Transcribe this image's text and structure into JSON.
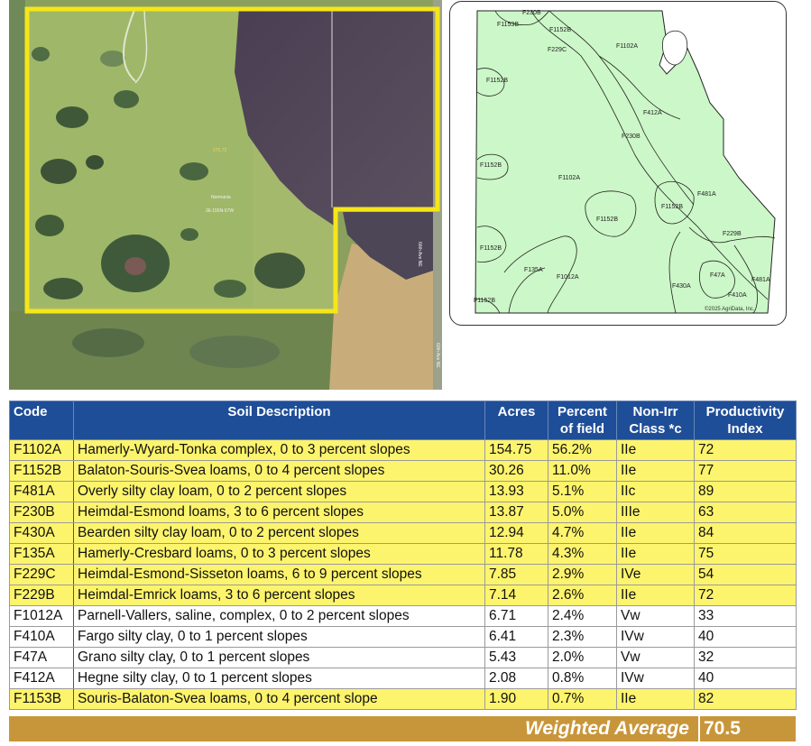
{
  "aerial": {
    "parcel_label": "Normania",
    "parcel_sublabel": "36-155N-57W",
    "acreage_label": "275.72",
    "road_label_1": "66th Ave NE",
    "road_label_2": "60th Ave NE"
  },
  "soil_map": {
    "labels": [
      "F230B",
      "F1153B",
      "F1152B",
      "F229C",
      "F1102A",
      "F1152B",
      "F412A",
      "F230B",
      "F1152B",
      "F1102A",
      "F481A",
      "F1152B",
      "F1152B",
      "F229B",
      "F1152B",
      "F135A",
      "F1012A",
      "F47A",
      "F481A",
      "F430A",
      "F410A",
      "F1152B"
    ],
    "copyright": "©2025 AgriData, Inc."
  },
  "table": {
    "headers": {
      "code": "Code",
      "description": "Soil Description",
      "acres": "Acres",
      "percent_1": "Percent",
      "percent_2": "of field",
      "class_1": "Non-Irr",
      "class_2": "Class *c",
      "pi_1": "Productivity",
      "pi_2": "Index"
    },
    "rows": [
      {
        "code": "F1102A",
        "description": "Hamerly-Wyard-Tonka complex, 0 to 3 percent slopes",
        "acres": "154.75",
        "percent": "56.2%",
        "class": "IIe",
        "pi": "72"
      },
      {
        "code": "F1152B",
        "description": "Balaton-Souris-Svea loams, 0 to 4 percent slopes",
        "acres": "30.26",
        "percent": "11.0%",
        "class": "IIe",
        "pi": "77"
      },
      {
        "code": "F481A",
        "description": "Overly silty clay loam, 0 to 2 percent slopes",
        "acres": "13.93",
        "percent": "5.1%",
        "class": "IIc",
        "pi": "89"
      },
      {
        "code": "F230B",
        "description": "Heimdal-Esmond loams, 3 to 6 percent slopes",
        "acres": "13.87",
        "percent": "5.0%",
        "class": "IIIe",
        "pi": "63"
      },
      {
        "code": "F430A",
        "description": "Bearden silty clay loam, 0 to 2 percent slopes",
        "acres": "12.94",
        "percent": "4.7%",
        "class": "IIe",
        "pi": "84"
      },
      {
        "code": "F135A",
        "description": "Hamerly-Cresbard loams, 0 to 3 percent slopes",
        "acres": "11.78",
        "percent": "4.3%",
        "class": "IIe",
        "pi": "75"
      },
      {
        "code": "F229C",
        "description": "Heimdal-Esmond-Sisseton loams, 6 to 9 percent slopes",
        "acres": "7.85",
        "percent": "2.9%",
        "class": "IVe",
        "pi": "54"
      },
      {
        "code": "F229B",
        "description": "Heimdal-Emrick loams, 3 to 6 percent slopes",
        "acres": "7.14",
        "percent": "2.6%",
        "class": "IIe",
        "pi": "72"
      },
      {
        "code": "F1012A",
        "description": "Parnell-Vallers, saline, complex, 0 to 2 percent slopes",
        "acres": "6.71",
        "percent": "2.4%",
        "class": "Vw",
        "pi": "33"
      },
      {
        "code": "F410A",
        "description": "Fargo silty clay, 0 to 1 percent slopes",
        "acres": "6.41",
        "percent": "2.3%",
        "class": "IVw",
        "pi": "40"
      },
      {
        "code": "F47A",
        "description": "Grano silty clay, 0 to 1 percent slopes",
        "acres": "5.43",
        "percent": "2.0%",
        "class": "Vw",
        "pi": "32"
      },
      {
        "code": "F412A",
        "description": "Hegne silty clay, 0 to 1 percent slopes",
        "acres": "2.08",
        "percent": "0.8%",
        "class": "IVw",
        "pi": "40"
      },
      {
        "code": "F1153B",
        "description": "Souris-Balaton-Svea loams, 0 to 4 percent slope",
        "acres": "1.90",
        "percent": "0.7%",
        "class": "IIe",
        "pi": "82"
      }
    ],
    "weighted_average_label": "Weighted Average",
    "weighted_average_value": "70.5"
  },
  "colors": {
    "header_blue": "#1f4e98",
    "row_highlight": "#fdf46d",
    "avg_bar": "#c8963a",
    "soil_fill": "#ccf7c8",
    "parcel_outline": "#f5e61a"
  }
}
